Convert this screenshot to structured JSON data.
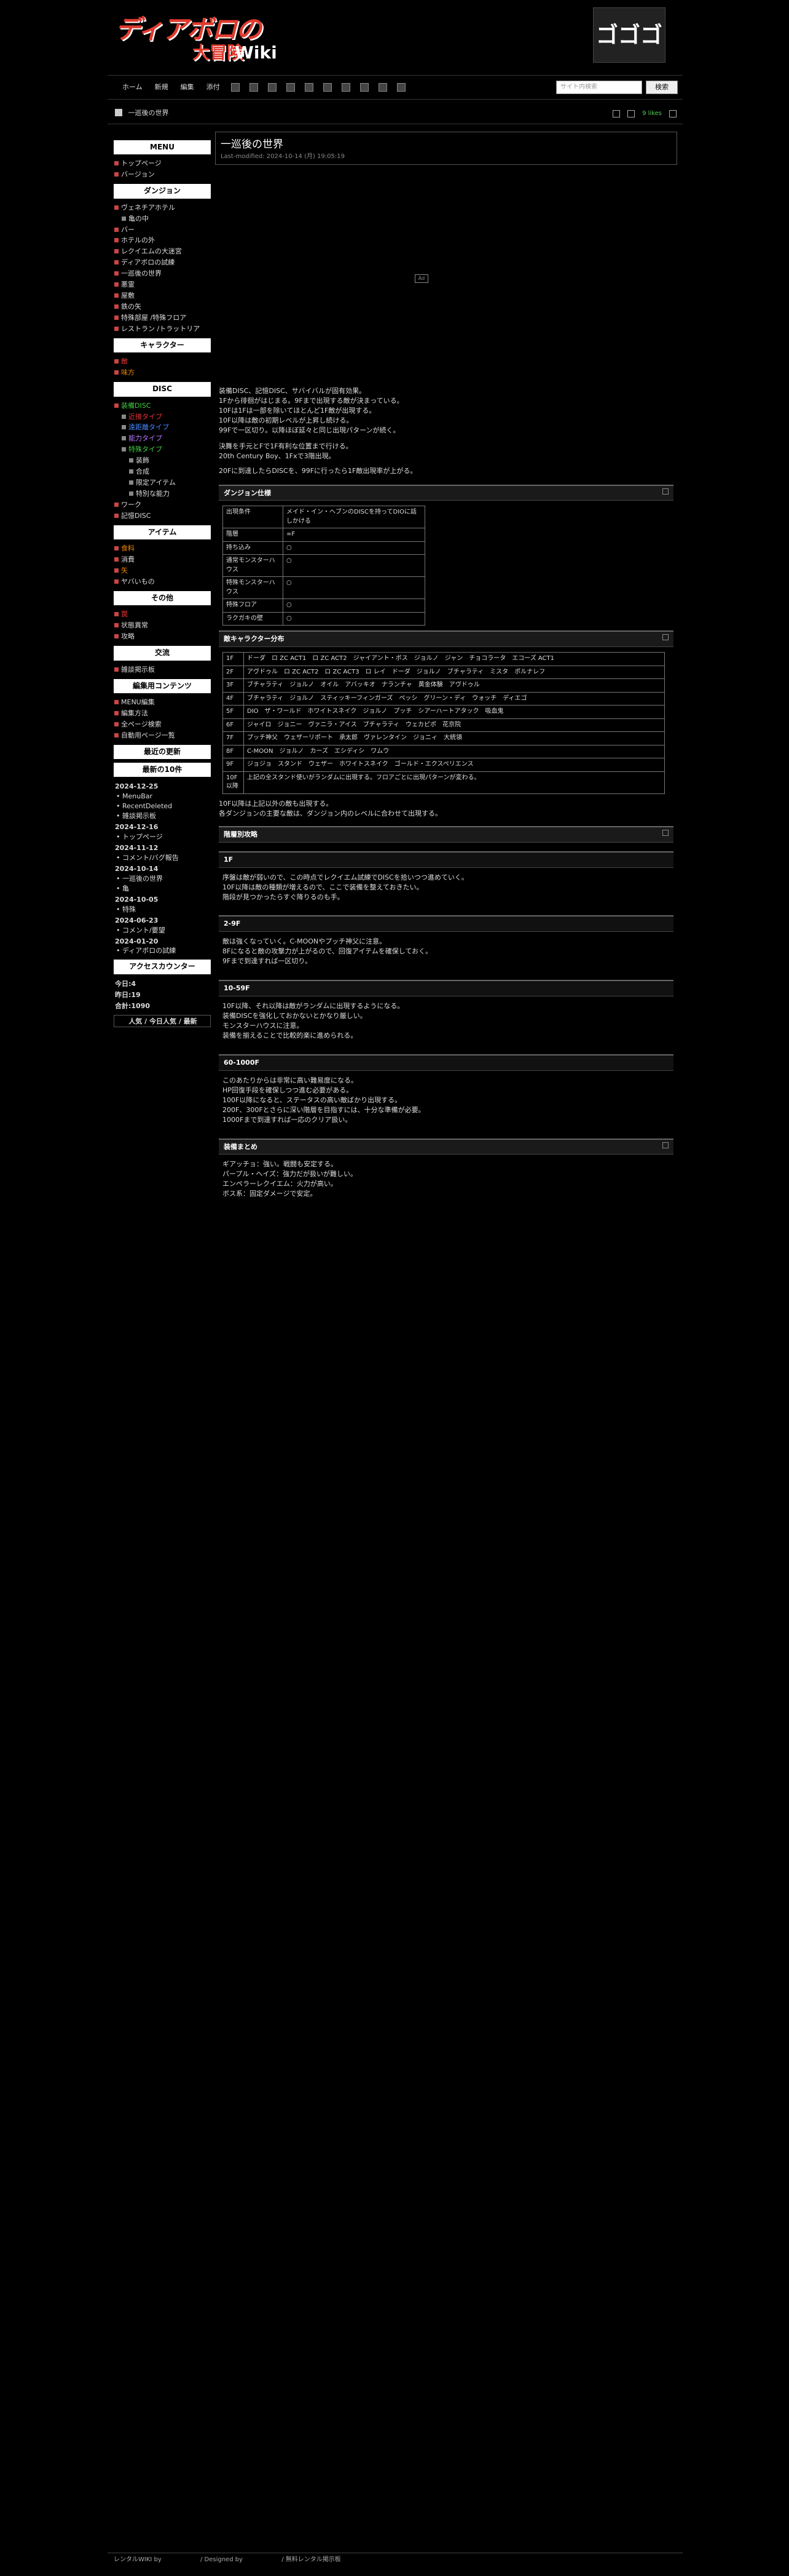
{
  "logo": {
    "text1": "ディアボロの",
    "text2": "大冒険",
    "wiki": "Wiki"
  },
  "header_image_text": "ゴゴゴ",
  "topnav": [
    "ホーム",
    "新規",
    "編集",
    "添付"
  ],
  "search": {
    "placeholder": "サイト内検索",
    "button": "検索"
  },
  "breadcrumb": "一巡後の世界",
  "view_count": "9 likes",
  "page": {
    "title": "一巡後の世界",
    "last_modified": "Last-modified: 2024-10-14 (月) 19:05:19"
  },
  "intro_lines": [
    "装備DISC、記憶DISC、サバイバルが固有効果。",
    "1Fから徘徊がはじまる。9Fまで出現する敵が決まっている。",
    "10Fは1Fは一部を除いてほとんど1F敵が出現する。",
    "10F以降は敵の初期レベルが上昇し続ける。",
    "99Fで一区切り。以降ほぼ延々と同じ出現パターンが続く。",
    "",
    "決舞を手元とFで1F有利な位置まで行ける。",
    "20th Century Boy、1Fxで3階出現。",
    "20Fに到達したらDISCを、99Fに行ったら1F敵出現率が上がる。"
  ],
  "sec1_title": "ダンジョン仕様",
  "spec_rows": [
    [
      "出現条件",
      "メイド・イン・ヘブンのDISCを持ってDIOに話しかける"
    ],
    [
      "階層",
      "∞F"
    ],
    [
      "持ち込み",
      "○"
    ],
    [
      "通常モンスターハウス",
      "○"
    ],
    [
      "特殊モンスターハウス",
      "○"
    ],
    [
      "特殊フロア",
      "○"
    ],
    [
      "ラクガキの壁",
      "○"
    ]
  ],
  "sec2_title": "敵キャラクター分布",
  "enemy_rows": [
    [
      "1F",
      "ドーダ　ロ ZC ACT1　ロ ZC ACT2　ジャイアント・ボス　ジョルノ　ジャン　チョコラータ　エコーズ ACT1"
    ],
    [
      "2F",
      "アヴドゥル　ロ ZC ACT2　ロ ZC ACT3　ロ レイ　ドーダ　ジョルノ　ブチャラティ　ミスタ　ポルナレフ"
    ],
    [
      "3F",
      "ブチャラティ　ジョルノ　オイル　アバッキオ　ナランチャ　黄金体験　アヴドゥル"
    ],
    [
      "4F",
      "ブチャラティ　ジョルノ　スティッキーフィンガーズ　ペッシ　グリーン・ディ　ウォッチ　ディエゴ"
    ],
    [
      "5F",
      "DIO　ザ・ワールド　ホワイトスネイク　ジョルノ　プッチ　シアーハートアタック　吸血鬼"
    ],
    [
      "6F",
      "ジャイロ　ジョニー　ヴァニラ・アイス　ブチャラティ　ウェカピポ　花京院"
    ],
    [
      "7F",
      "プッチ神父　ウェザーリポート　承太郎　ヴァレンタイン　ジョニィ　大統領"
    ],
    [
      "8F",
      "C-MOON　ジョルノ　カーズ　エシディシ　ワムウ"
    ],
    [
      "9F",
      "ジョジョ　スタンド　ウェザー　ホワイトスネイク　ゴールド・エクスペリエンス"
    ],
    [
      "10F以降",
      "上記の全スタンド使いがランダムに出現する。フロアごとに出現パターンが変わる。"
    ]
  ],
  "enemy_note": [
    "10F以降は上記以外の敵も出現する。",
    "各ダンジョンの主要な敵は、ダンジョン内のレベルに合わせて出現する。"
  ],
  "sec3_title": "階層別攻略",
  "subsecs": [
    {
      "t": "1F",
      "lines": [
        "序盤は敵が弱いので、この時点でレクイエム試練でDISCを拾いつつ進めていく。",
        "10F以降は敵の種類が増えるので、ここで装備を整えておきたい。",
        "階段が見つかったらすぐ降りるのも手。"
      ]
    },
    {
      "t": "2-9F",
      "lines": [
        "敵は強くなっていく。C-MOONやプッチ神父に注意。",
        "8Fになると敵の攻撃力が上がるので、回復アイテムを確保しておく。",
        "9Fまで到達すれば一区切り。"
      ]
    },
    {
      "t": "10-59F",
      "lines": [
        "10F以降、それ以降は敵がランダムに出現するようになる。",
        "装備DISCを強化しておかないとかなり厳しい。",
        "モンスターハウスに注意。",
        "装備を揃えることで比較的楽に進められる。"
      ]
    },
    {
      "t": "60-1000F",
      "lines": [
        "このあたりからは非常に高い難易度になる。",
        "HP回復手段を確保しつつ進む必要がある。",
        "100F以降になると、ステータスの高い敵ばかり出現する。",
        "200F、300Fとさらに深い階層を目指すには、十分な準備が必要。",
        "1000Fまで到達すれば一応のクリア扱い。"
      ]
    }
  ],
  "sec4_title": "装備まとめ",
  "equip_lines": [
    "ギアッチョ：強い。戦闘も安定する。",
    "パープル・ヘイズ：強力だが扱いが難しい。",
    "エンペラーレクイエム：火力が高い。",
    "ボス系：固定ダメージで安定。"
  ],
  "footer": {
    "left": "レンタルWIKI by",
    "mid": "/ Designed by",
    "right": "/ 無料レンタル掲示板"
  },
  "sidebar": {
    "menu": "MENU",
    "top": "トップページ",
    "version": "バージョン",
    "dungeon_h": "ダンジョン",
    "dungeons": [
      "ヴェネチアホテル",
      "亀の中",
      "バー",
      "ホテルの外",
      "レクイエムの大迷宮",
      "ディアボロの試練",
      "一巡後の世界",
      "悪霊",
      "屋敷",
      "鉄の矢",
      "特殊部屋 /特殊フロア",
      "レストラン /トラットリア"
    ],
    "chara_h": "キャラクター",
    "charas": [
      "敵",
      "味方"
    ],
    "disc_h": "DISC",
    "discs": [
      "装備DISC",
      "近接タイプ",
      "遠距離タイプ",
      "能力タイプ",
      "特殊タイプ",
      "装飾",
      "合成",
      "限定アイテム",
      "特別な能力",
      "ワーク",
      "記憶DISC"
    ],
    "item_h": "アイテム",
    "items": [
      "食料",
      "消費",
      "矢",
      "ヤバいもの"
    ],
    "other_h": "その他",
    "others": [
      "罠",
      "状態異常",
      "攻略"
    ],
    "comm_h": "交流",
    "comms": [
      "雑談掲示板"
    ],
    "edit_h": "編集用コンテンツ",
    "edits": [
      "MENU編集",
      "編集方法",
      "全ページ検索",
      "自動用ページ一覧"
    ],
    "recent_h": "最近の更新",
    "recent10_h": "最新の10件",
    "recent": [
      {
        "d": "2024-12-25",
        "items": [
          "MenuBar",
          "RecentDeleted",
          "雑談掲示板"
        ]
      },
      {
        "d": "2024-12-16",
        "items": [
          "トップページ"
        ]
      },
      {
        "d": "2024-11-12",
        "items": [
          "コメント/バグ報告"
        ]
      },
      {
        "d": "2024-10-14",
        "items": [
          "一巡後の世界",
          "亀"
        ]
      },
      {
        "d": "2024-10-05",
        "items": [
          "特殊"
        ]
      },
      {
        "d": "2024-06-23",
        "items": [
          "コメント/要望"
        ]
      },
      {
        "d": "2024-01-20",
        "items": [
          "ディアボロの試練"
        ]
      }
    ],
    "counter_h": "アクセスカウンター",
    "counter": [
      "今日:4",
      "昨日:19",
      "合計:1090"
    ],
    "counter_btns": "人気 / 今日人気 / 最新"
  },
  "chart_data": null
}
